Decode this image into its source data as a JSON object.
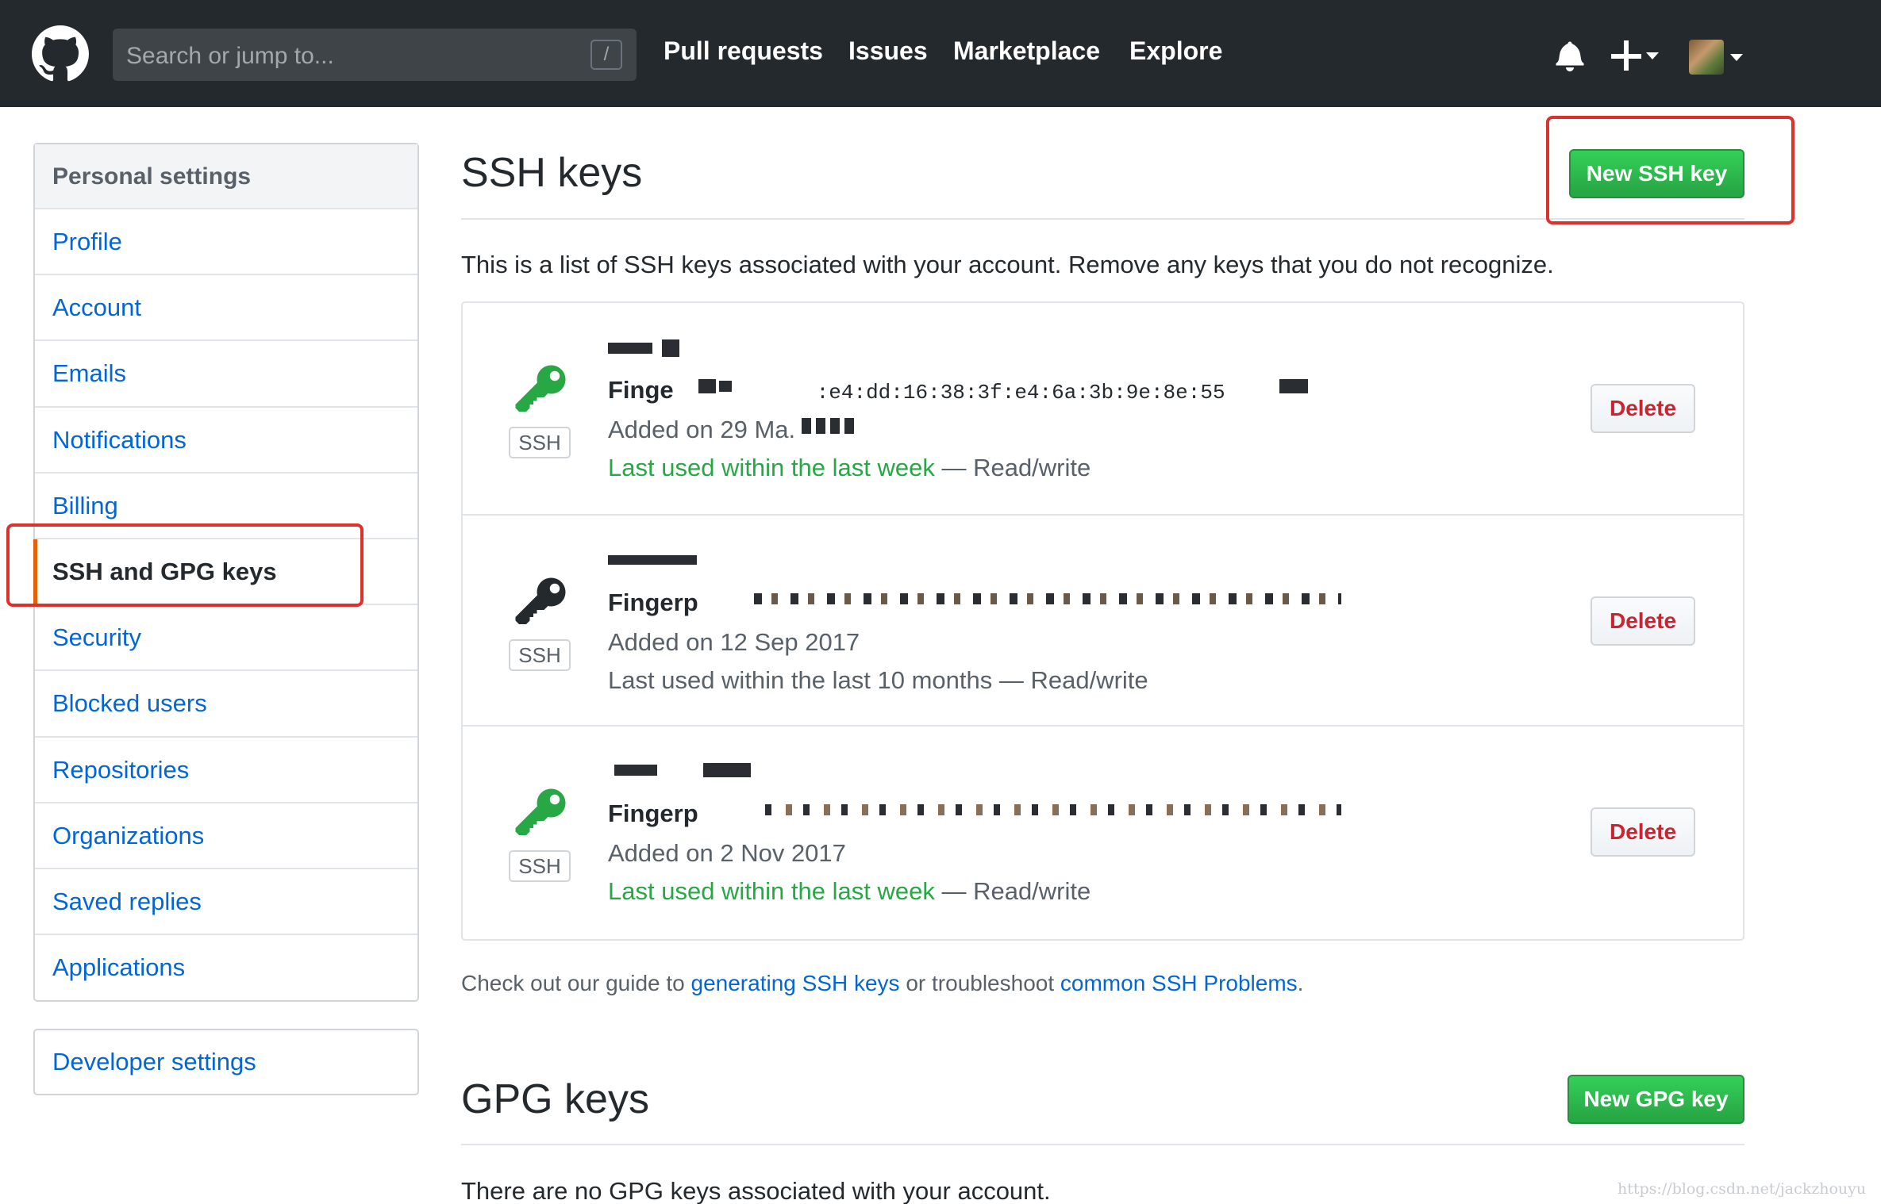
{
  "header": {
    "search_placeholder": "Search or jump to...",
    "search_shortcut": "/",
    "nav": [
      "Pull requests",
      "Issues",
      "Marketplace",
      "Explore"
    ],
    "icons": [
      "github-logo",
      "bell-icon",
      "plus-icon",
      "avatar"
    ]
  },
  "sidebar": {
    "heading": "Personal settings",
    "items": [
      {
        "label": "Profile",
        "selected": false
      },
      {
        "label": "Account",
        "selected": false
      },
      {
        "label": "Emails",
        "selected": false
      },
      {
        "label": "Notifications",
        "selected": false
      },
      {
        "label": "Billing",
        "selected": false
      },
      {
        "label": "SSH and GPG keys",
        "selected": true
      },
      {
        "label": "Security",
        "selected": false
      },
      {
        "label": "Blocked users",
        "selected": false
      },
      {
        "label": "Repositories",
        "selected": false
      },
      {
        "label": "Organizations",
        "selected": false
      },
      {
        "label": "Saved replies",
        "selected": false
      },
      {
        "label": "Applications",
        "selected": false
      }
    ],
    "developer_settings": "Developer settings"
  },
  "ssh": {
    "title": "SSH keys",
    "new_button": "New SSH key",
    "intro": "This is a list of SSH keys associated with your account. Remove any keys that you do not recognize.",
    "keys": [
      {
        "fingerprint_label": "Finge",
        "fingerprint_value": ":e4:dd:16:38:3f:e4:6a:3b:9e:8e:55",
        "added": "Added on 29 Ma.",
        "last_used": "Last used within the last week",
        "access": " — Read/write",
        "recent": true,
        "icon_color": "#28a745",
        "badge": "SSH",
        "delete": "Delete"
      },
      {
        "fingerprint_label": "Fingerp",
        "fingerprint_value": "",
        "added": "Added on 12 Sep 2017",
        "last_used": "Last used within the last 10 months",
        "access": " — Read/write",
        "recent": false,
        "icon_color": "#24292e",
        "badge": "SSH",
        "delete": "Delete"
      },
      {
        "fingerprint_label": "Fingerp",
        "fingerprint_value": "",
        "added": "Added on 2 Nov 2017",
        "last_used": "Last used within the last week",
        "access": " — Read/write",
        "recent": true,
        "icon_color": "#28a745",
        "badge": "SSH",
        "delete": "Delete"
      }
    ],
    "guide_prefix": "Check out our guide to ",
    "guide_link1": "generating SSH keys",
    "guide_middle": " or troubleshoot ",
    "guide_link2": "common SSH Problems",
    "guide_suffix": "."
  },
  "gpg": {
    "title": "GPG keys",
    "new_button": "New GPG key",
    "empty": "There are no GPG keys associated with your account."
  },
  "watermark": "https://blog.csdn.net/jackzhouyu",
  "colors": {
    "header_bg": "#24292e",
    "link": "#0366d6",
    "green": "#28a745",
    "danger": "#cb2431",
    "annotation": "#e0302b",
    "selected_marker": "#e36209"
  }
}
